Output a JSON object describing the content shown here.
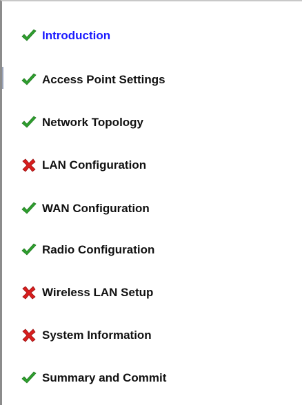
{
  "wizard": {
    "steps": [
      {
        "label": "Introduction",
        "status": "complete",
        "active": true
      },
      {
        "label": "Access Point Settings",
        "status": "complete",
        "active": false
      },
      {
        "label": "Network Topology",
        "status": "complete",
        "active": false
      },
      {
        "label": "LAN Configuration",
        "status": "error",
        "active": false
      },
      {
        "label": "WAN Configuration",
        "status": "complete",
        "active": false
      },
      {
        "label": "Radio Configuration",
        "status": "complete",
        "active": false
      },
      {
        "label": "Wireless LAN Setup",
        "status": "error",
        "active": false
      },
      {
        "label": "System Information",
        "status": "error",
        "active": false
      },
      {
        "label": "Summary and Commit",
        "status": "complete",
        "active": false
      }
    ]
  },
  "icons": {
    "complete": "check-icon",
    "error": "error-x-icon"
  },
  "colors": {
    "active_label": "#1a1aff",
    "label": "#111111",
    "check": "#2e9e2e",
    "error": "#d81e1e"
  }
}
